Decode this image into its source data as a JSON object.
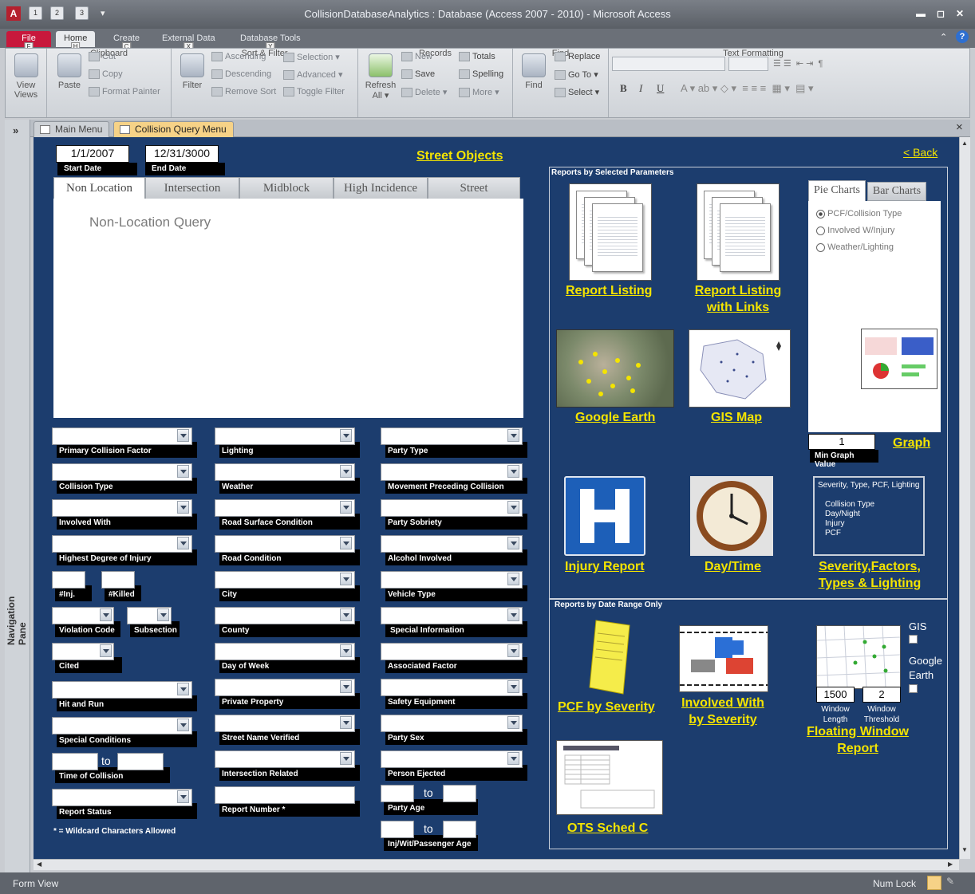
{
  "window": {
    "title": "CollisionDatabaseAnalytics : Database (Access 2007 - 2010) - Microsoft Access",
    "app_letter": "A",
    "qa_keys": [
      "1",
      "2",
      "3"
    ]
  },
  "ribbon_tabs": [
    {
      "label": "File",
      "key": "F"
    },
    {
      "label": "Home",
      "key": "H"
    },
    {
      "label": "Create",
      "key": "C"
    },
    {
      "label": "External Data",
      "key": "X"
    },
    {
      "label": "Database Tools",
      "key": "Y"
    }
  ],
  "ribbon": {
    "views": {
      "view": "View",
      "group": "Views"
    },
    "clipboard": {
      "paste": "Paste",
      "cut": "Cut",
      "copy": "Copy",
      "format_painter": "Format Painter",
      "group": "Clipboard"
    },
    "sort": {
      "filter": "Filter",
      "ascending": "Ascending",
      "descending": "Descending",
      "remove_sort": "Remove Sort",
      "selection": "Selection ▾",
      "advanced": "Advanced ▾",
      "toggle_filter": "Toggle Filter",
      "group": "Sort & Filter"
    },
    "records": {
      "refresh": "Refresh",
      "refresh2": "All ▾",
      "new": "New",
      "save": "Save",
      "delete": "Delete ▾",
      "totals": "Totals",
      "spelling": "Spelling",
      "more": "More ▾",
      "group": "Records"
    },
    "find": {
      "find": "Find",
      "replace": "Replace",
      "goto": "Go To ▾",
      "select": "Select ▾",
      "group": "Find"
    },
    "text": {
      "bold": "B",
      "italic": "I",
      "underline": "U",
      "group": "Text Formatting"
    }
  },
  "nav": {
    "toggle": "»",
    "label": "Navigation Pane"
  },
  "doc_tabs": [
    {
      "label": "Main Menu"
    },
    {
      "label": "Collision Query Menu"
    }
  ],
  "close": "×",
  "form": {
    "start_date": "1/1/2007",
    "start_label": "Start Date",
    "end_date": "12/31/3000",
    "end_label": "End Date",
    "street_objects": "Street Objects",
    "back": "< Back",
    "tabs": [
      "Non Location",
      "Intersection",
      "Midblock",
      "High Incidence",
      "Street"
    ],
    "query_title": "Non-Location Query",
    "col1": [
      "Primary Collision Factor",
      "Collision Type",
      "Involved With",
      "Highest Degree of Injury"
    ],
    "inj": "#Inj.",
    "killed": "#Killed",
    "violation": "Violation Code",
    "subsection": "Subsection",
    "cited": "Cited",
    "col1b": [
      "Hit and Run",
      "Special Conditions"
    ],
    "time_to": "to",
    "time_label": "Time of Collision",
    "report_status": "Report Status",
    "wildcard": "* = Wildcard Characters Allowed",
    "col2": [
      "Lighting",
      "Weather",
      "Road Surface Condition",
      "Road Condition",
      "City",
      "County",
      "Day of Week",
      "Private Property",
      "Street Name Verified",
      "Intersection Related"
    ],
    "report_number": "Report Number *",
    "col3": [
      "Party Type",
      "Movement Preceding Collision",
      "Party Sobriety",
      "Alcohol Involved",
      "Vehicle Type",
      "Special Information",
      "Associated Factor",
      "Safety Equipment",
      "Party Sex",
      "Person Ejected"
    ],
    "party_age": "Party Age",
    "age_to": "to",
    "inj_age": "Inj/Wit/Passenger Age"
  },
  "reports": {
    "selected_caption": "Reports by Selected Parameters",
    "report_listing": "Report Listing",
    "report_links_1": "Report Listing",
    "report_links_2": "with Links",
    "google_earth": "Google Earth",
    "gis_map": "GIS Map",
    "chart_tabs": [
      "Pie Charts",
      "Bar Charts"
    ],
    "chart_options": [
      "PCF/Collision Type",
      "Involved W/Injury",
      "Weather/Lighting"
    ],
    "min_graph_value": "1",
    "min_graph_label": "Min Graph Value",
    "graph": "Graph",
    "injury_report": "Injury Report",
    "day_time": "Day/Time",
    "severity_box_title": "Severity, Type, PCF, Lighting",
    "severity_box_items": [
      "Collision Type",
      "Day/Night",
      "Injury",
      "PCF"
    ],
    "severity_1": "Severity,Factors,",
    "severity_2": "Types & Lighting",
    "date_caption": "Reports by Date Range Only",
    "pcf_severity": "PCF by Severity",
    "involved_1": "Involved With",
    "involved_2": "by Severity",
    "gis": "GIS",
    "google_1": "Google",
    "google_2": "Earth",
    "window_length": "1500",
    "window_threshold": "2",
    "wl_1": "Window",
    "wl_2": "Length",
    "wt_1": "Window",
    "wt_2": "Threshold",
    "floating_1": "Floating Window",
    "floating_2": "Report",
    "ots": "OTS Sched C"
  },
  "status": {
    "left": "Form View",
    "right": "Num Lock"
  }
}
